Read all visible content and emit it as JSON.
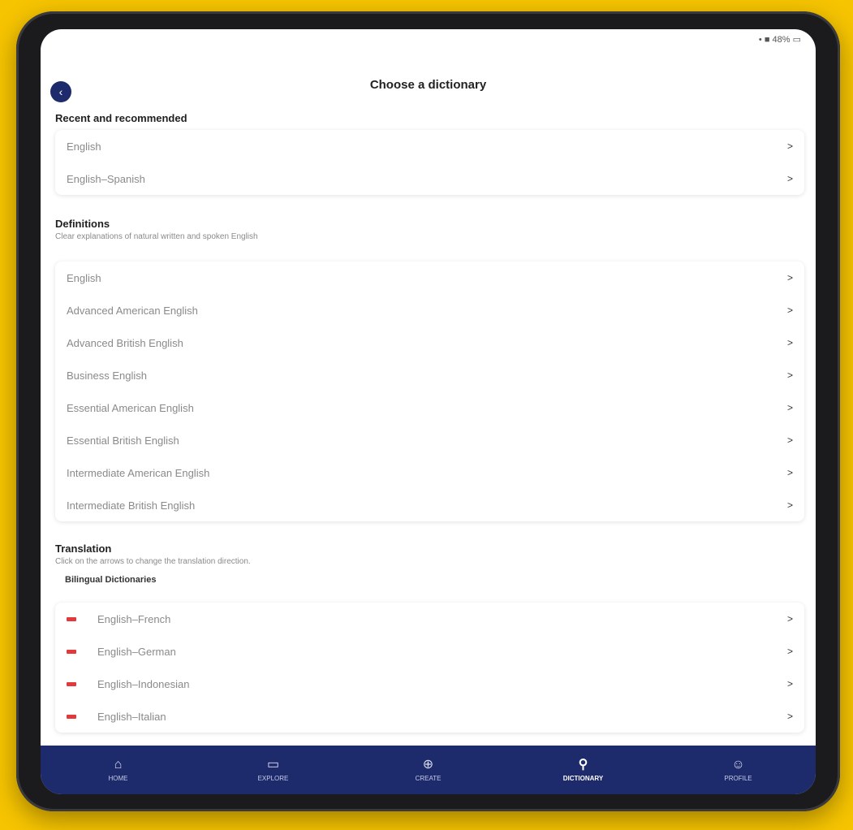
{
  "status_bar": {
    "text": "• ■ 48% ▭"
  },
  "header": {
    "title": "Choose a dictionary",
    "back_icon": "back-icon"
  },
  "recent": {
    "title": "Recent and recommended",
    "items": [
      {
        "label": "English"
      },
      {
        "label": "English–Spanish"
      }
    ]
  },
  "definitions": {
    "title": "Definitions",
    "subtitle": "Clear explanations of natural written and spoken English",
    "items": [
      {
        "label": "English"
      },
      {
        "label": "Advanced American English"
      },
      {
        "label": "Advanced British English"
      },
      {
        "label": "Business English"
      },
      {
        "label": "Essential American English"
      },
      {
        "label": "Essential British English"
      },
      {
        "label": "Intermediate American English"
      },
      {
        "label": "Intermediate British English"
      }
    ]
  },
  "translation": {
    "title": "Translation",
    "subtitle": "Click on the arrows to change the translation direction.",
    "bilingual_title": "Bilingual Dictionaries",
    "items": [
      {
        "label": "English–French"
      },
      {
        "label": "English–German"
      },
      {
        "label": "English–Indonesian"
      },
      {
        "label": "English–Italian"
      }
    ]
  },
  "bottom_nav": {
    "items": [
      {
        "label": "HOME",
        "icon": "home-icon"
      },
      {
        "label": "EXPLORE",
        "icon": "explore-icon"
      },
      {
        "label": "CREATE",
        "icon": "create-icon"
      },
      {
        "label": "DICTIONARY",
        "icon": "search-icon",
        "active": true
      },
      {
        "label": "PROFILE",
        "icon": "profile-icon"
      }
    ]
  },
  "colors": {
    "background": "#f6c400",
    "navy": "#1d2a6b",
    "flag": "#e23a3a"
  }
}
